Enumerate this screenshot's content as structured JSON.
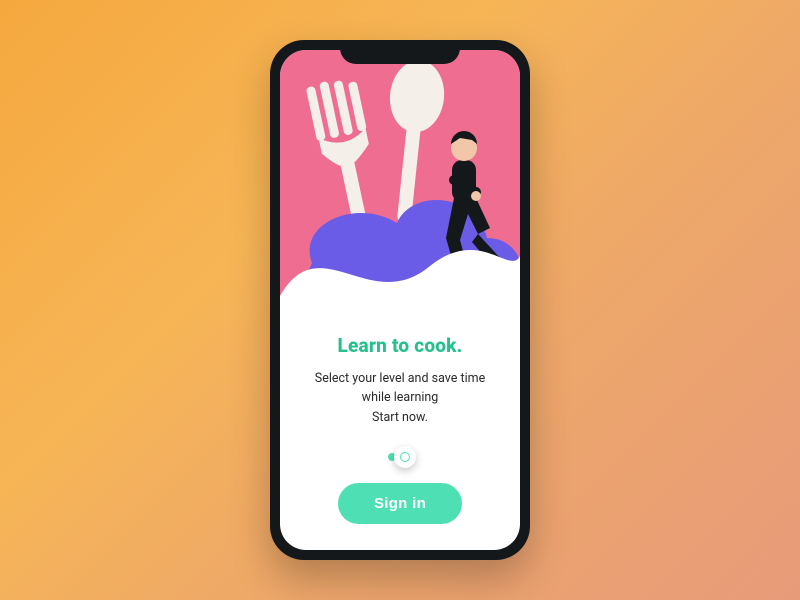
{
  "colors": {
    "background_gradient_from": "#f5a83e",
    "background_gradient_to": "#e89b7a",
    "hero_bg": "#ee6d91",
    "blob": "#6b5ce7",
    "accent": "#4ee0b4",
    "title": "#25c18c",
    "phone_frame": "#14181b"
  },
  "illustration": {
    "icons": [
      "fork-icon",
      "spoon-icon",
      "seated-person-icon",
      "cloud-blob-icon"
    ]
  },
  "onboarding": {
    "title": "Learn to cook.",
    "subtitle_line1": "Select your level and save time",
    "subtitle_line2": "while learning",
    "subtitle_line3": "Start now.",
    "pager": {
      "count": 2,
      "active_index": 0
    },
    "cta_label": "Sign in"
  }
}
